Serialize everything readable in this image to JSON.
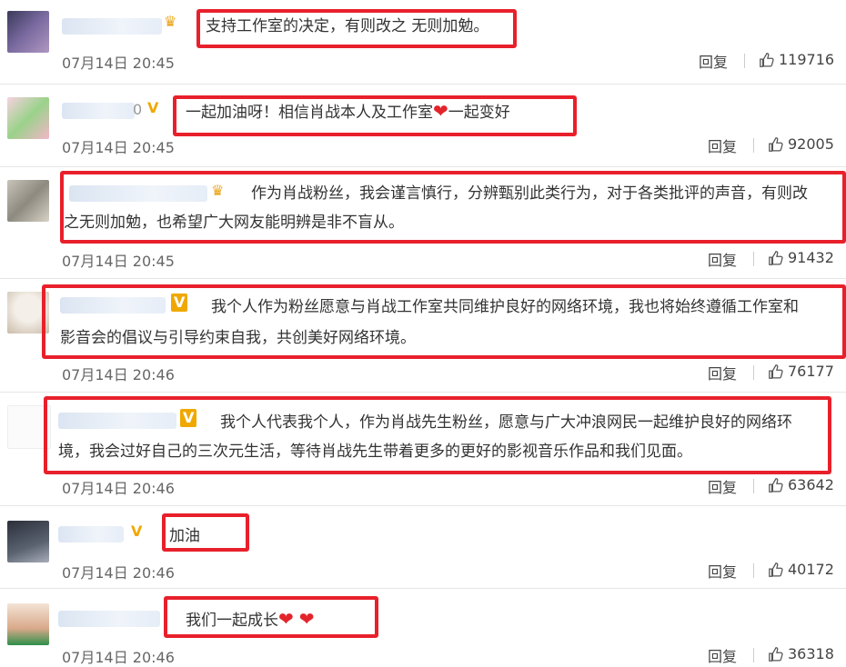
{
  "comments": [
    {
      "text": "支持工作室的决定，有则改之 无则加勉。",
      "time": "07月14日 20:45",
      "reply": "回复",
      "likes": "119716",
      "badge": "♛"
    },
    {
      "text_a": "一起加油呀！相信肖战本人及工作室",
      "text_b": "一起变好",
      "time": "07月14日 20:45",
      "reply": "回复",
      "likes": "92005",
      "badge": "V",
      "username_fragment": "0"
    },
    {
      "line1": "作为肖战粉丝，我会谨言慎行，分辨甄别此类行为，对于各类批评的声音，有则改",
      "line2": "之无则加勉，也希望广大网友能明辨是非不盲从。",
      "time": "07月14日 20:45",
      "reply": "回复",
      "likes": "91432",
      "badge": "♛"
    },
    {
      "line1": "我个人作为粉丝愿意与肖战工作室共同维护良好的网络环境，我也将始终遵循工作室和",
      "line2": "影音会的倡议与引导约束自我，共创美好网络环境。",
      "time": "07月14日 20:46",
      "reply": "回复",
      "likes": "76177",
      "badge": "V"
    },
    {
      "line1": "我个人代表我个人，作为肖战先生粉丝，愿意与广大冲浪网民一起维护良好的网络环",
      "line2": "境，我会过好自己的三次元生活，等待肖战先生带着更多的更好的影视音乐作品和我们见面。",
      "time": "07月14日 20:46",
      "reply": "回复",
      "likes": "63642",
      "badge": "V"
    },
    {
      "text": "加油",
      "time": "07月14日 20:46",
      "reply": "回复",
      "likes": "40172",
      "badge": "V"
    },
    {
      "text": "我们一起成长",
      "time": "07月14日 20:46",
      "reply": "回复",
      "likes": "36318",
      "badge": ""
    }
  ],
  "colors": {
    "highlight": "#e8202b",
    "badge_gold": "#f0a800",
    "heart": "#e3242b"
  },
  "icons": {
    "like": "thumbs-up-icon",
    "heart": "heart-icon",
    "crown": "crown-icon",
    "verified": "verified-v-icon"
  }
}
